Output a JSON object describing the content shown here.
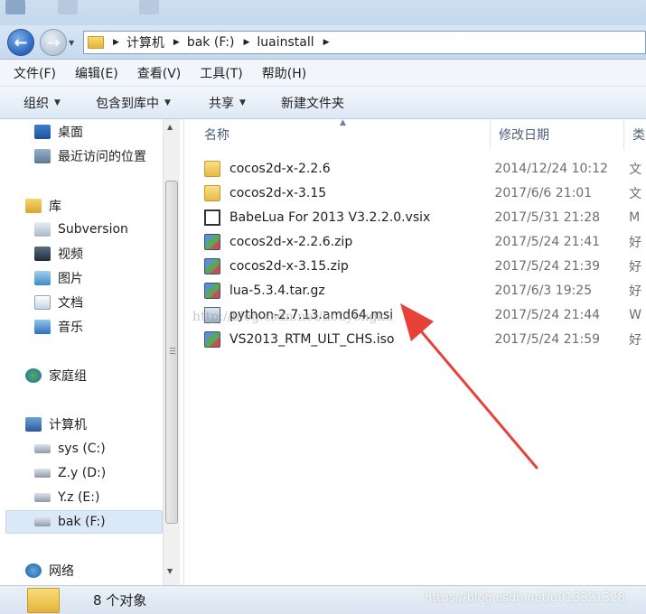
{
  "window": {
    "address": {
      "crumbs": [
        "计算机",
        "bak (F:)",
        "luainstall"
      ]
    }
  },
  "menu": [
    "文件(F)",
    "编辑(E)",
    "查看(V)",
    "工具(T)",
    "帮助(H)"
  ],
  "toolbar": {
    "organize": "组织",
    "include_library": "包含到库中",
    "share": "共享",
    "new_folder": "新建文件夹"
  },
  "nav": {
    "desktop": "桌面",
    "recent": "最近访问的位置",
    "libraries": "库",
    "subversion": "Subversion",
    "videos": "视频",
    "pictures": "图片",
    "documents": "文档",
    "music": "音乐",
    "homegroup": "家庭组",
    "computer": "计算机",
    "drive_c": "sys (C:)",
    "drive_d": "Z.y (D:)",
    "drive_e": "Y.z (E:)",
    "drive_f": "bak (F:)",
    "network": "网络"
  },
  "columns": {
    "name": "名称",
    "date": "修改日期",
    "type": "类"
  },
  "files": [
    {
      "name": "cocos2d-x-2.2.6",
      "date": "2014/12/24 10:12",
      "type": "文",
      "icon": "folder-icon"
    },
    {
      "name": "cocos2d-x-3.15",
      "date": "2017/6/6 21:01",
      "type": "文",
      "icon": "folder-icon"
    },
    {
      "name": "BabeLua For 2013 V3.2.2.0.vsix",
      "date": "2017/5/31 21:28",
      "type": "M",
      "icon": "vsix-icon"
    },
    {
      "name": "cocos2d-x-2.2.6.zip",
      "date": "2017/5/24 21:41",
      "type": "好",
      "icon": "archive-icon"
    },
    {
      "name": "cocos2d-x-3.15.zip",
      "date": "2017/5/24 21:39",
      "type": "好",
      "icon": "archive-icon"
    },
    {
      "name": "lua-5.3.4.tar.gz",
      "date": "2017/6/3 19:25",
      "type": "好",
      "icon": "archive-icon"
    },
    {
      "name": "python-2.7.13.amd64.msi",
      "date": "2017/5/24 21:44",
      "type": "W",
      "icon": "msi-icon"
    },
    {
      "name": "VS2013_RTM_ULT_CHS.iso",
      "date": "2017/5/24 21:59",
      "type": "好",
      "icon": "archive-icon"
    }
  ],
  "status": {
    "count": "8 个对象"
  },
  "watermarks": {
    "mid": "http://blog.csdn.net/houyongku",
    "bottom": "https://blog.csdn.net/u013321328"
  },
  "colors": {
    "annotation_arrow": "#e8413a",
    "selection": "#dbe8f7"
  }
}
